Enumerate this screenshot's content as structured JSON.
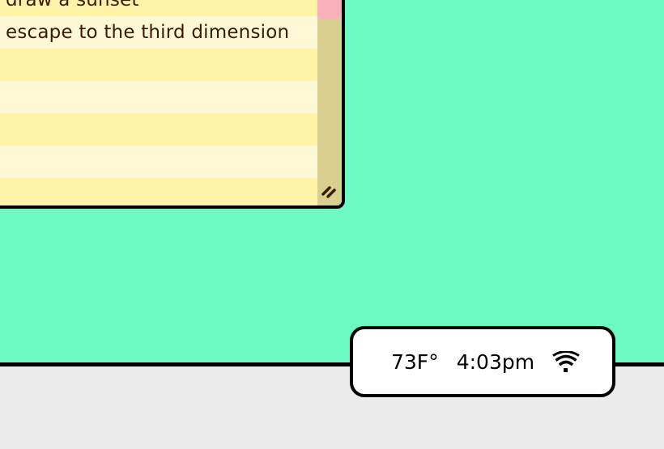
{
  "notes": {
    "items": [
      "draw a sunset",
      "escape to the third dimension",
      "",
      "",
      "",
      "",
      ""
    ]
  },
  "status": {
    "temperature": "73F°",
    "time": "4:03pm",
    "wifi_icon": "wifi-icon"
  },
  "colors": {
    "desktop": "#6cf9c3",
    "note_light": "#fff8d6",
    "note_dark": "#fff3a8",
    "scrollbar": "#d9cf8f",
    "scroll_thumb": "#f9b0b8",
    "floor": "#ececec"
  }
}
